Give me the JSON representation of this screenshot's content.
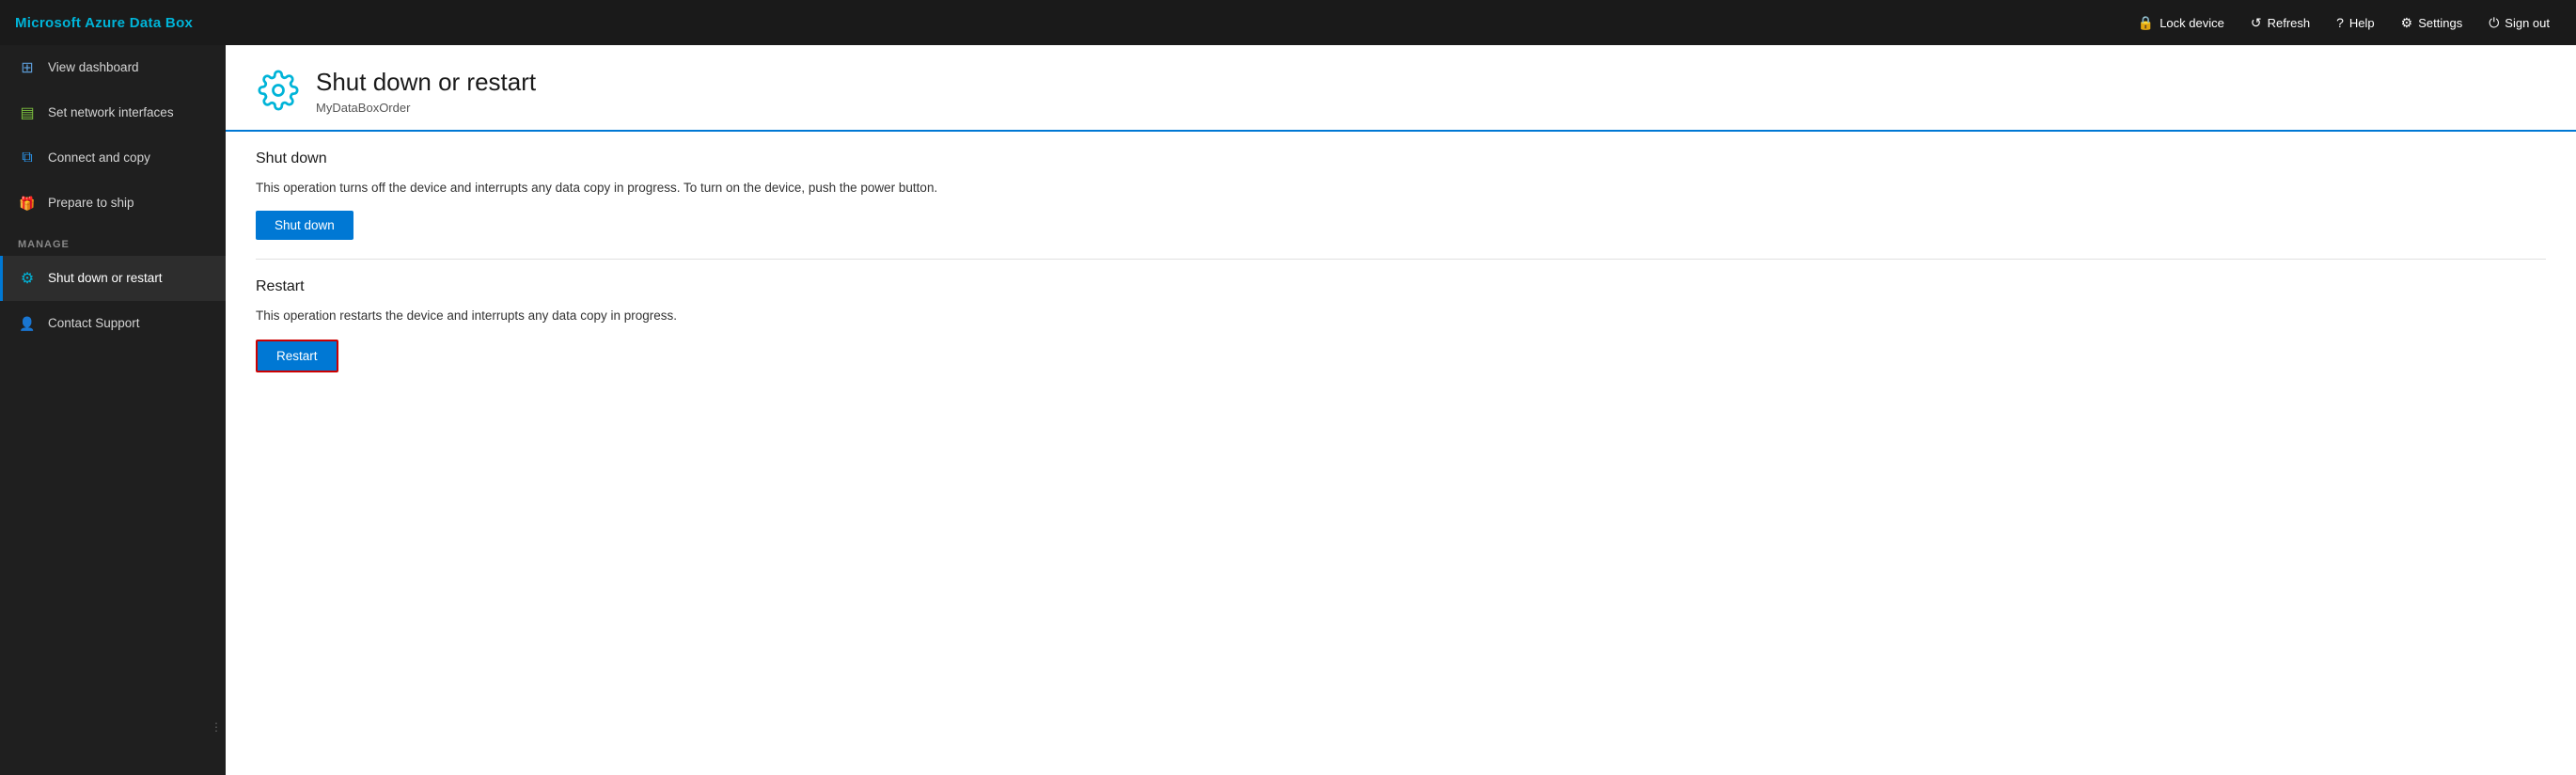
{
  "app": {
    "title": "Microsoft Azure Data Box"
  },
  "topbar": {
    "buttons": [
      {
        "id": "lock-device",
        "label": "Lock device",
        "icon": "🔒"
      },
      {
        "id": "refresh",
        "label": "Refresh",
        "icon": "↺"
      },
      {
        "id": "help",
        "label": "Help",
        "icon": "?"
      },
      {
        "id": "settings",
        "label": "Settings",
        "icon": "⚙"
      },
      {
        "id": "sign-out",
        "label": "Sign out",
        "icon": "⏻"
      }
    ]
  },
  "sidebar": {
    "items": [
      {
        "id": "view-dashboard",
        "label": "View dashboard",
        "icon": "grid",
        "active": false
      },
      {
        "id": "set-network-interfaces",
        "label": "Set network interfaces",
        "icon": "network",
        "active": false
      },
      {
        "id": "connect-and-copy",
        "label": "Connect and copy",
        "icon": "copy",
        "active": false
      },
      {
        "id": "prepare-to-ship",
        "label": "Prepare to ship",
        "icon": "ship",
        "active": false
      }
    ],
    "manage_section_label": "MANAGE",
    "manage_items": [
      {
        "id": "shut-down-or-restart",
        "label": "Shut down or restart",
        "icon": "gear",
        "active": true
      },
      {
        "id": "contact-support",
        "label": "Contact Support",
        "icon": "support",
        "active": false
      }
    ]
  },
  "page": {
    "icon": "⚙",
    "title": "Shut down or restart",
    "subtitle": "MyDataBoxOrder",
    "sections": [
      {
        "id": "shutdown",
        "title": "Shut down",
        "description": "This operation turns off the device and interrupts any data copy in progress. To turn on the device, push the power button.",
        "button_label": "Shut down"
      },
      {
        "id": "restart",
        "title": "Restart",
        "description": "This operation restarts the device and interrupts any data copy in progress.",
        "button_label": "Restart"
      }
    ]
  }
}
